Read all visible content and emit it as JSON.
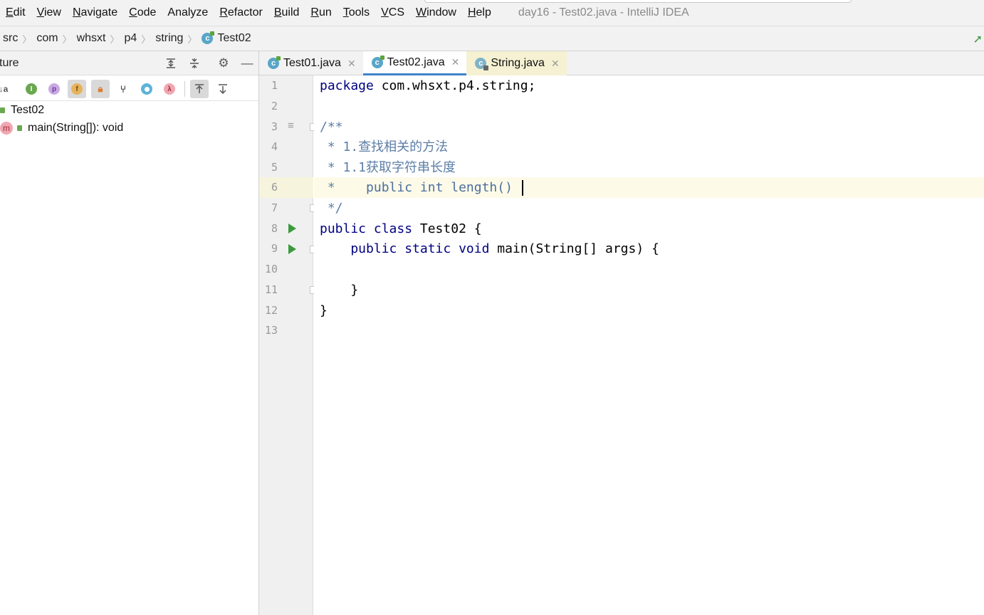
{
  "menubar": {
    "items": [
      {
        "mn": "E",
        "rest": "dit"
      },
      {
        "mn": "V",
        "rest": "iew"
      },
      {
        "mn": "N",
        "rest": "avigate"
      },
      {
        "mn": "C",
        "rest": "ode"
      },
      {
        "mn": "",
        "rest": "Analyze"
      },
      {
        "mn": "R",
        "rest": "efactor"
      },
      {
        "mn": "B",
        "rest": "uild"
      },
      {
        "mn": "R",
        "rest": "un"
      },
      {
        "mn": "T",
        "rest": "ools"
      },
      {
        "mn": "V",
        "rest": "CS"
      },
      {
        "mn": "W",
        "rest": "indow"
      },
      {
        "mn": "H",
        "rest": "elp"
      }
    ],
    "window_title": "day16 - Test02.java - IntelliJ IDEA"
  },
  "breadcrumb": {
    "items": [
      "src",
      "com",
      "whsxt",
      "p4",
      "string"
    ],
    "current": "Test02"
  },
  "structure": {
    "title": "ture",
    "tree": {
      "class_name": "Test02",
      "method": "main(String[]): void",
      "method_icon": "m"
    }
  },
  "tabs": [
    {
      "label": "Test01.java"
    },
    {
      "label": "Test02.java"
    },
    {
      "label": "String.java"
    }
  ],
  "editor": {
    "line_numbers": [
      "1",
      "2",
      "3",
      "4",
      "5",
      "6",
      "7",
      "8",
      "9",
      "10",
      "11",
      "12",
      "13"
    ],
    "lines": {
      "l1_kw": "package",
      "l1_rest": " com.whsxt.p4.string;",
      "l3": "/**",
      "l4": " * 1.查找相关的方法",
      "l5": " * 1.1获取字符串长度",
      "l6_prefix": " *    ",
      "l6_code": "public int length() ",
      "l7": " */",
      "l8_kw": "public class",
      "l8_rest": " Test02 {",
      "l9_kw": "    public static void",
      "l9_rest": " main(String[] args) {",
      "l11": "    }",
      "l12": "}"
    }
  },
  "colors": {
    "keyword": "#000080",
    "comment": "#5d7fa8",
    "run_arrow": "#3b9a3b",
    "tab_underline": "#4083c9"
  }
}
